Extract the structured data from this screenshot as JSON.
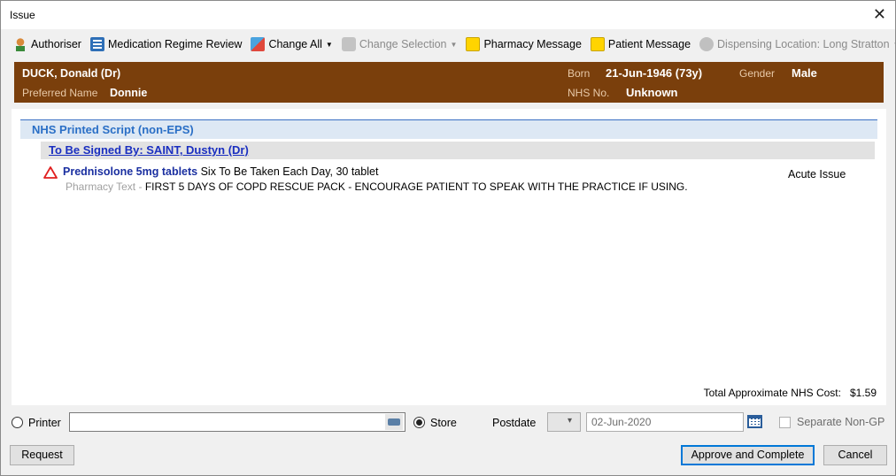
{
  "window": {
    "title": "Issue",
    "close_glyph": "✕"
  },
  "toolbar": {
    "items": [
      {
        "label": "Authoriser",
        "icon": "person-icon",
        "enabled": true
      },
      {
        "label": "Medication Regime Review",
        "icon": "calendar-list-icon",
        "enabled": true
      },
      {
        "label": "Change All",
        "icon": "change-icon",
        "enabled": true,
        "dropdown": true
      },
      {
        "label": "Change Selection",
        "icon": "change-selection-icon",
        "enabled": false,
        "dropdown": true
      },
      {
        "label": "Pharmacy Message",
        "icon": "sticky-note-icon",
        "enabled": true
      },
      {
        "label": "Patient Message",
        "icon": "sticky-note-icon",
        "enabled": true
      },
      {
        "label": "Dispensing Location: Long Stratton",
        "icon": "location-icon",
        "enabled": false,
        "dropdown": true
      }
    ]
  },
  "patient": {
    "name": "DUCK, Donald (Dr)",
    "preferred_name_label": "Preferred Name",
    "preferred_name": "Donnie",
    "born_label": "Born",
    "born": "21-Jun-1946 (73y)",
    "gender_label": "Gender",
    "gender": "Male",
    "nhs_label": "NHS No.",
    "nhs": "Unknown",
    "banner_color": "#7a3f0c"
  },
  "script": {
    "section_title": "NHS Printed Script (non-EPS)",
    "signed_by": "To Be Signed By: SAINT, Dustyn (Dr)",
    "items": [
      {
        "drug": "Prednisolone 5mg tablets",
        "dosage": " Six To Be Taken Each Day, 30 tablet",
        "pharmacy_label": "Pharmacy Text - ",
        "pharmacy_text": "FIRST 5 DAYS OF COPD RESCUE PACK - ENCOURAGE PATIENT TO SPEAK WITH THE PRACTICE IF USING.",
        "issue_type": "Acute Issue",
        "warning_icon": "warning-triangle-icon"
      }
    ],
    "cost_label": "Total Approximate NHS Cost:",
    "cost_value": "$1.59"
  },
  "output": {
    "printer_label": "Printer",
    "printer_value": "",
    "store_label": "Store",
    "store_selected": true,
    "postdate_label": "Postdate",
    "postdate_value": "02-Jun-2020",
    "separate_label": "Separate Non-GP",
    "separate_checked": false
  },
  "buttons": {
    "request": "Request",
    "approve": "Approve and Complete",
    "cancel": "Cancel"
  }
}
